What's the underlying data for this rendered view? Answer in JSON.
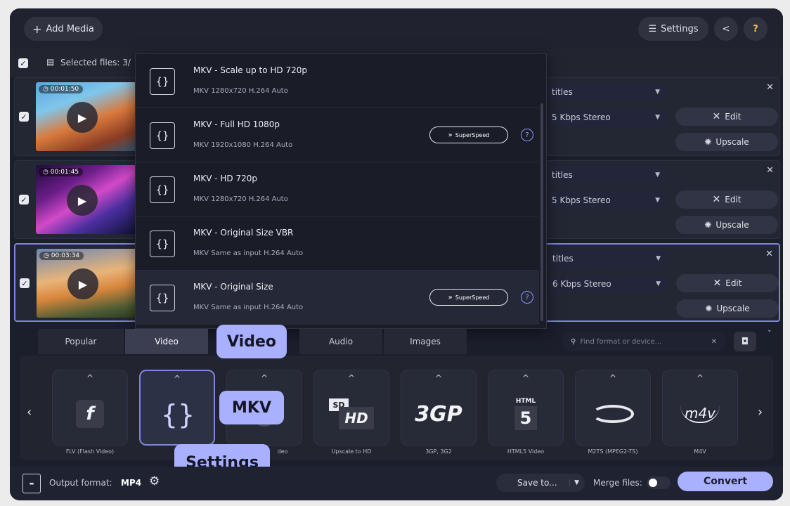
{
  "toolbar": {
    "add_media_label": "Add Media",
    "settings_label": "Settings",
    "help_label": "?"
  },
  "selection": {
    "label": "Selected files: 3/"
  },
  "files": [
    {
      "duration": "00:01:50",
      "subtitles": "titles",
      "audio": "5 Kbps Stereo",
      "edit": "Edit",
      "upscale": "Upscale"
    },
    {
      "duration": "00:01:45",
      "subtitles": "titles",
      "audio": "5 Kbps Stereo",
      "edit": "Edit",
      "upscale": "Upscale"
    },
    {
      "duration": "00:03:34",
      "subtitles": "titles",
      "audio": "6 Kbps Stereo",
      "edit": "Edit",
      "upscale": "Upscale"
    }
  ],
  "presets": [
    {
      "title": "MKV - Scale up to HD 720p",
      "spec": "MKV   1280x720   H.264   Auto",
      "superspeed": false
    },
    {
      "title": "MKV - Full HD 1080p",
      "spec": "MKV   1920x1080   H.264   Auto",
      "superspeed": true
    },
    {
      "title": "MKV - HD 720p",
      "spec": "MKV   1280x720   H.264   Auto",
      "superspeed": false
    },
    {
      "title": "MKV - Original Size VBR",
      "spec": "MKV   Same as input   H.264   Auto",
      "superspeed": false
    },
    {
      "title": "MKV - Original Size",
      "spec": "MKV   Same as input   H.264   Auto",
      "superspeed": true
    }
  ],
  "superspeed_label": "SuperSpeed",
  "tabs": [
    "Popular",
    "Video",
    "Audio",
    "Images"
  ],
  "search": {
    "placeholder": "Find format or device..."
  },
  "formats": [
    {
      "name": "FLV (Flash Video)",
      "icon": "flv-icon"
    },
    {
      "name": "M",
      "icon": "mkv-icon"
    },
    {
      "name": "deo",
      "icon": "video-icon"
    },
    {
      "name": "Upscale to HD",
      "icon": "hd-icon"
    },
    {
      "name": "3GP, 3G2",
      "icon": "3gp-icon"
    },
    {
      "name": "HTML5 Video",
      "icon": "html5-icon"
    },
    {
      "name": "M2TS (MPEG2-TS)",
      "icon": "bluray-icon"
    },
    {
      "name": "M4V",
      "icon": "m4v-icon"
    }
  ],
  "callouts": {
    "video": "Video",
    "mkv": "MKV",
    "settings": "Settings"
  },
  "footer": {
    "output_label": "Output format:",
    "output_value": "MP4",
    "save_to": "Save to...",
    "merge_label": "Merge files:",
    "convert": "Convert"
  },
  "colors": {
    "accent": "#a8b0ff",
    "background": "#1b1e2b",
    "selected_border": "#7d86d8"
  }
}
